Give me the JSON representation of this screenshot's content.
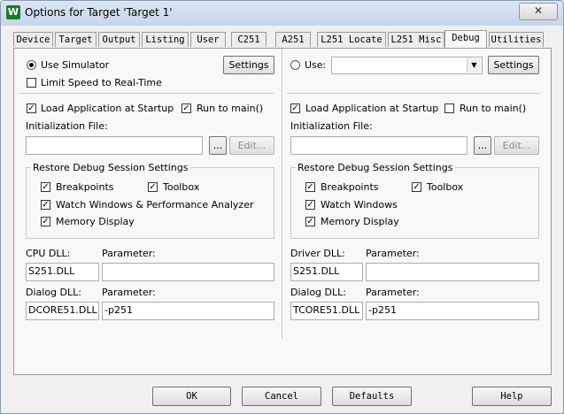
{
  "window": {
    "title": "Options for Target 'Target 1'",
    "close_glyph": "✕"
  },
  "tabs": [
    "Device",
    "Target",
    "Output",
    "Listing",
    "User",
    "C251",
    "A251",
    "L251 Locate",
    "L251 Misc",
    "Debug",
    "Utilities"
  ],
  "active_tab": "Debug",
  "left": {
    "use_simulator": "Use Simulator",
    "settings": "Settings",
    "limit_speed": "Limit Speed to Real-Time",
    "load_app": "Load Application at Startup",
    "run_to_main": "Run to main()",
    "init_file_label": "Initialization File:",
    "init_file_value": "",
    "browse": "...",
    "edit": "Edit...",
    "restore_title": "Restore Debug Session Settings",
    "breakpoints": "Breakpoints",
    "toolbox": "Toolbox",
    "watch_windows": "Watch Windows & Performance Analyzer",
    "memory_display": "Memory Display",
    "cpu_dll_label": "CPU DLL:",
    "cpu_dll_value": "S251.DLL",
    "cpu_param_label": "Parameter:",
    "cpu_param_value": "",
    "dialog_dll_label": "Dialog DLL:",
    "dialog_dll_value": "DCORE51.DLL",
    "dialog_param_label": "Parameter:",
    "dialog_param_value": "-p251"
  },
  "right": {
    "use": "Use:",
    "driver_value": "",
    "settings": "Settings",
    "load_app": "Load Application at Startup",
    "run_to_main": "Run to main()",
    "init_file_label": "Initialization File:",
    "init_file_value": "",
    "browse": "...",
    "edit": "Edit...",
    "restore_title": "Restore Debug Session Settings",
    "breakpoints": "Breakpoints",
    "toolbox": "Toolbox",
    "watch_windows": "Watch Windows",
    "memory_display": "Memory Display",
    "driver_dll_label": "Driver DLL:",
    "driver_dll_value": "S251.DLL",
    "driver_param_label": "Parameter:",
    "driver_param_value": "",
    "dialog_dll_label": "Dialog DLL:",
    "dialog_dll_value": "TCORE51.DLL",
    "dialog_param_label": "Parameter:",
    "dialog_param_value": "-p251"
  },
  "buttons": {
    "ok": "OK",
    "cancel": "Cancel",
    "defaults": "Defaults",
    "help": "Help"
  },
  "check_glyph": "✓"
}
